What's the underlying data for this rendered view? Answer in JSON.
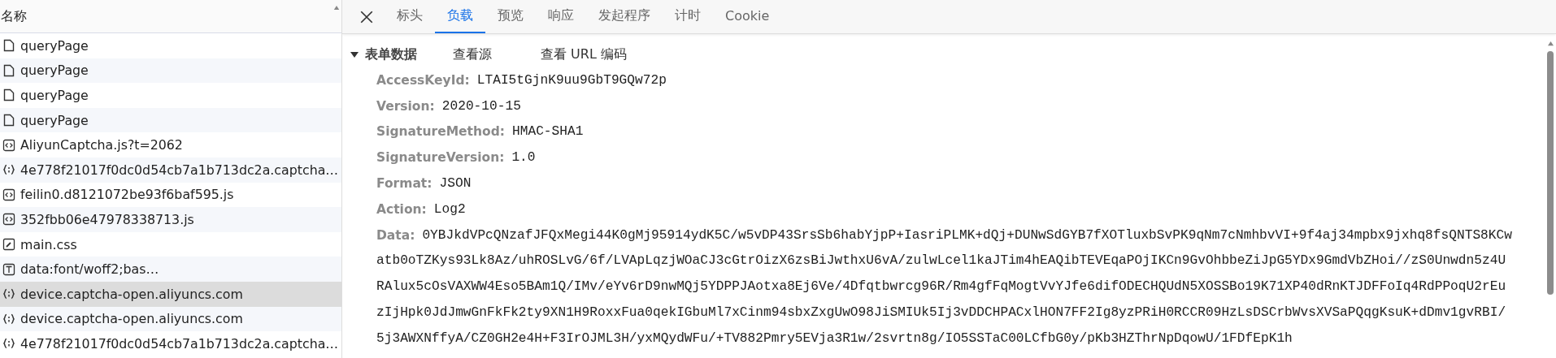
{
  "request_list": {
    "header": "名称",
    "items": [
      {
        "name": "queryPage",
        "kind": "document",
        "selected": false
      },
      {
        "name": "queryPage",
        "kind": "document",
        "selected": false
      },
      {
        "name": "queryPage",
        "kind": "document",
        "selected": false
      },
      {
        "name": "queryPage",
        "kind": "document",
        "selected": false
      },
      {
        "name": "AliyunCaptcha.js?t=2062",
        "kind": "script",
        "selected": false
      },
      {
        "name": "4e778f21017f0dc0d54cb7a1b713dc2a.captcha…",
        "kind": "json",
        "selected": false
      },
      {
        "name": "feilin0.d8121072be93f6baf595.js",
        "kind": "script",
        "selected": false
      },
      {
        "name": "352fbb06e47978338713.js",
        "kind": "script",
        "selected": false
      },
      {
        "name": "main.css",
        "kind": "stylesheet",
        "selected": false
      },
      {
        "name": "data:font/woff2;bas…",
        "kind": "font",
        "selected": false
      },
      {
        "name": "device.captcha-open.aliyuncs.com",
        "kind": "json",
        "selected": true
      },
      {
        "name": "device.captcha-open.aliyuncs.com",
        "kind": "json",
        "selected": false
      },
      {
        "name": "4e778f21017f0dc0d54cb7a1b713dc2a.captcha…",
        "kind": "json",
        "selected": false
      }
    ]
  },
  "tabs": [
    {
      "label": "标头",
      "selected": false
    },
    {
      "label": "负载",
      "selected": true
    },
    {
      "label": "预览",
      "selected": false
    },
    {
      "label": "响应",
      "selected": false
    },
    {
      "label": "发起程序",
      "selected": false
    },
    {
      "label": "计时",
      "selected": false
    },
    {
      "label": "Cookie",
      "selected": false
    }
  ],
  "form_data": {
    "title": "表单数据",
    "expanded": true,
    "actions": [
      "查看源",
      "查看 URL 编码"
    ],
    "fields": [
      {
        "key": "AccessKeyId:",
        "value": [
          "LTAI5tGjnK9uu9GbT9GQw72p"
        ]
      },
      {
        "key": "Version:",
        "value": [
          "2020-10-15"
        ]
      },
      {
        "key": "SignatureMethod:",
        "value": [
          "HMAC-SHA1"
        ]
      },
      {
        "key": "SignatureVersion:",
        "value": [
          "1.0"
        ]
      },
      {
        "key": "Format:",
        "value": [
          "JSON"
        ]
      },
      {
        "key": "Action:",
        "value": [
          "Log2"
        ]
      },
      {
        "key": "Data:",
        "value": [
          "0YBJkdVPcQNzafJFQxMegi44K0gMj95914ydK5C/w5vDP43SrsSb6habYjpP+IasriPLMK+dQj+DUNwSdGYB7fXOTluxbSvPK9qNm7cNmhbvVI+9f4aj34mpbx9jxhq8fsQNTS8KCw",
          "atb0oTZKys93Lk8Az/uhROSLvG/6f/LVApLqzjWOaCJ3cGtrOizX6zsBiJwthxU6vA/zulwLcel1kaJTim4hEAQibTEVEqaPOjIKCn9GvOhbbeZiJpG5YDx9GmdVbZHoi//zS0Unwdn5z4U",
          "RAlux5cOsVAXWW4Eso5BAm1Q/IMv/eYv6rD9nwMQj5YDPPJAotxa8Ej6Ve/4Dfqtbwrcg96R/Rm4gfFqMogtVvYJfe6difODECHQUdN5XOSSBo19K71XP40dRnKTJDFFoIq4RdPPoqU2rEu",
          "zIjHpk0JdJmwGnFkFk2ty9XN1H9RoxxFua0qekIGbuMl7xCinm94sbxZxgUwO98JiSMIUk5Ij3vDDCHPACxlHON7FF2Ig8yzPRiH0RCCR09HzLsDSCrbWvsXVSaPQqgKsuK+dDmv1gvRBI/",
          "5j3AWXNffyA/CZ0GH2e4H+F3IrOJML3H/yxMQydWFu/+TV882Pmry5EVja3R1w/2svrtn8g/IO5SSTaC00LCfbG0y/pKb3HZThrNpDqowU/1FDfEpK1h"
        ]
      }
    ]
  }
}
